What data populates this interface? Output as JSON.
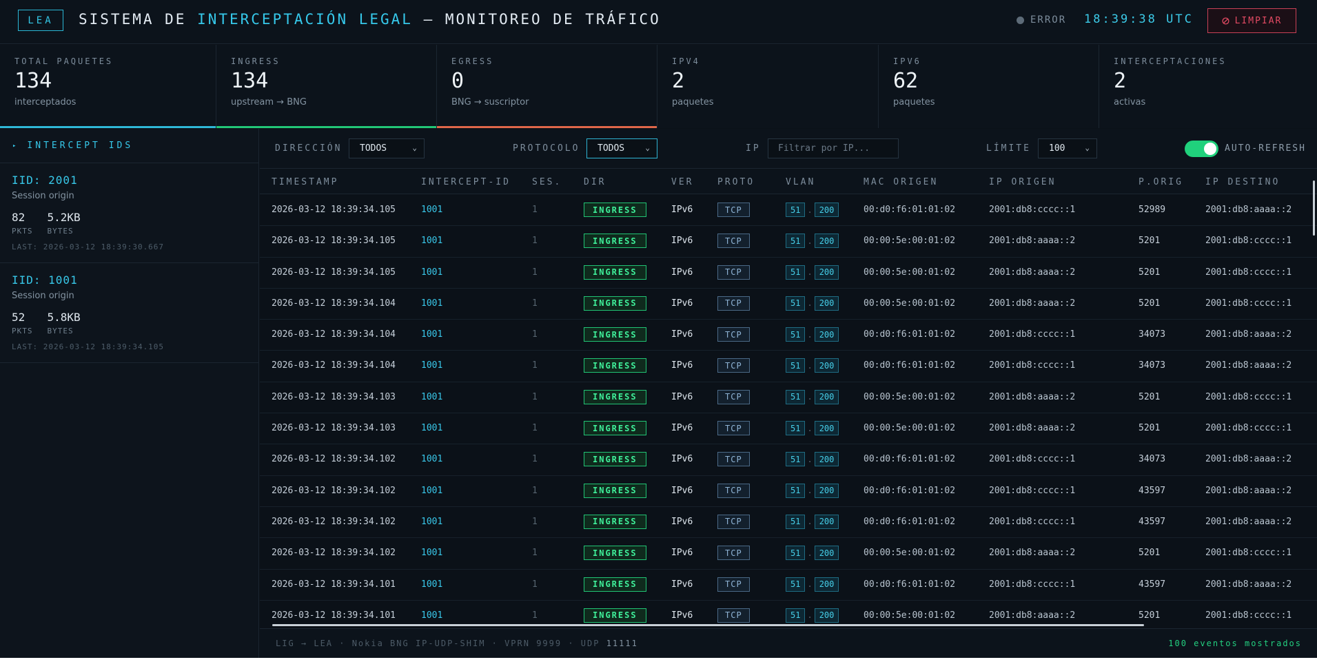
{
  "header": {
    "logo": "LEA",
    "title_pre": "SISTEMA DE ",
    "title_hl": "INTERCEPTACIÓN LEGAL",
    "title_post": " — MONITOREO DE TRÁFICO",
    "status": "ERROR",
    "clock": "18:39:38 UTC",
    "clear_label": "LIMPIAR",
    "clear_icon": "ban-icon"
  },
  "stats": [
    {
      "label": "TOTAL PAQUETES",
      "value": "134",
      "sub": "interceptados",
      "color": "#2fb8d8"
    },
    {
      "label": "INGRESS",
      "value": "134",
      "sub": "upstream → BNG",
      "color": "#22c777"
    },
    {
      "label": "EGRESS",
      "value": "0",
      "sub": "BNG → suscriptor",
      "color": "#e0674a"
    },
    {
      "label": "IPV4",
      "value": "2",
      "sub": "paquetes",
      "color": ""
    },
    {
      "label": "IPV6",
      "value": "62",
      "sub": "paquetes",
      "color": ""
    },
    {
      "label": "INTERCEPTACIONES",
      "value": "2",
      "sub": "activas",
      "color": ""
    }
  ],
  "sidebar": {
    "title": "INTERCEPT IDS",
    "cards": [
      {
        "iid": "IID: 2001",
        "origin": "Session origin",
        "pkts": "82",
        "bytes": "5.2KB",
        "pkts_label": "PKTS",
        "bytes_label": "BYTES",
        "last": "LAST: 2026-03-12 18:39:30.667"
      },
      {
        "iid": "IID: 1001",
        "origin": "Session origin",
        "pkts": "52",
        "bytes": "5.8KB",
        "pkts_label": "PKTS",
        "bytes_label": "BYTES",
        "last": "LAST: 2026-03-12 18:39:34.105"
      }
    ]
  },
  "filters": {
    "direction_label": "DIRECCIÓN",
    "direction_value": "TODOS",
    "protocol_label": "PROTOCOLO",
    "protocol_value": "TODOS",
    "ip_label": "IP",
    "ip_placeholder": "Filtrar por IP...",
    "limit_label": "LÍMITE",
    "limit_value": "100",
    "autorefresh_label": "AUTO-REFRESH",
    "autorefresh_on": true
  },
  "table": {
    "columns": [
      "TIMESTAMP",
      "INTERCEPT-ID",
      "SES.",
      "DIR",
      "VER",
      "PROTO",
      "VLAN",
      "MAC ORIGEN",
      "IP ORIGEN",
      "P.ORIG",
      "IP DESTINO"
    ],
    "rows": [
      {
        "ts": "2026-03-12 18:39:34.105",
        "iid": "1001",
        "ses": "1",
        "dir": "INGRESS",
        "ver": "IPv6",
        "proto": "TCP",
        "vlan_outer": "51",
        "vlan_inner": "200",
        "mac": "00:d0:f6:01:01:02",
        "ip_src": "2001:db8:cccc::1",
        "port": "52989",
        "ip_dst": "2001:db8:aaaa::2"
      },
      {
        "ts": "2026-03-12 18:39:34.105",
        "iid": "1001",
        "ses": "1",
        "dir": "INGRESS",
        "ver": "IPv6",
        "proto": "TCP",
        "vlan_outer": "51",
        "vlan_inner": "200",
        "mac": "00:00:5e:00:01:02",
        "ip_src": "2001:db8:aaaa::2",
        "port": "5201",
        "ip_dst": "2001:db8:cccc::1"
      },
      {
        "ts": "2026-03-12 18:39:34.105",
        "iid": "1001",
        "ses": "1",
        "dir": "INGRESS",
        "ver": "IPv6",
        "proto": "TCP",
        "vlan_outer": "51",
        "vlan_inner": "200",
        "mac": "00:00:5e:00:01:02",
        "ip_src": "2001:db8:aaaa::2",
        "port": "5201",
        "ip_dst": "2001:db8:cccc::1"
      },
      {
        "ts": "2026-03-12 18:39:34.104",
        "iid": "1001",
        "ses": "1",
        "dir": "INGRESS",
        "ver": "IPv6",
        "proto": "TCP",
        "vlan_outer": "51",
        "vlan_inner": "200",
        "mac": "00:00:5e:00:01:02",
        "ip_src": "2001:db8:aaaa::2",
        "port": "5201",
        "ip_dst": "2001:db8:cccc::1"
      },
      {
        "ts": "2026-03-12 18:39:34.104",
        "iid": "1001",
        "ses": "1",
        "dir": "INGRESS",
        "ver": "IPv6",
        "proto": "TCP",
        "vlan_outer": "51",
        "vlan_inner": "200",
        "mac": "00:d0:f6:01:01:02",
        "ip_src": "2001:db8:cccc::1",
        "port": "34073",
        "ip_dst": "2001:db8:aaaa::2"
      },
      {
        "ts": "2026-03-12 18:39:34.104",
        "iid": "1001",
        "ses": "1",
        "dir": "INGRESS",
        "ver": "IPv6",
        "proto": "TCP",
        "vlan_outer": "51",
        "vlan_inner": "200",
        "mac": "00:d0:f6:01:01:02",
        "ip_src": "2001:db8:cccc::1",
        "port": "34073",
        "ip_dst": "2001:db8:aaaa::2"
      },
      {
        "ts": "2026-03-12 18:39:34.103",
        "iid": "1001",
        "ses": "1",
        "dir": "INGRESS",
        "ver": "IPv6",
        "proto": "TCP",
        "vlan_outer": "51",
        "vlan_inner": "200",
        "mac": "00:00:5e:00:01:02",
        "ip_src": "2001:db8:aaaa::2",
        "port": "5201",
        "ip_dst": "2001:db8:cccc::1"
      },
      {
        "ts": "2026-03-12 18:39:34.103",
        "iid": "1001",
        "ses": "1",
        "dir": "INGRESS",
        "ver": "IPv6",
        "proto": "TCP",
        "vlan_outer": "51",
        "vlan_inner": "200",
        "mac": "00:00:5e:00:01:02",
        "ip_src": "2001:db8:aaaa::2",
        "port": "5201",
        "ip_dst": "2001:db8:cccc::1"
      },
      {
        "ts": "2026-03-12 18:39:34.102",
        "iid": "1001",
        "ses": "1",
        "dir": "INGRESS",
        "ver": "IPv6",
        "proto": "TCP",
        "vlan_outer": "51",
        "vlan_inner": "200",
        "mac": "00:d0:f6:01:01:02",
        "ip_src": "2001:db8:cccc::1",
        "port": "34073",
        "ip_dst": "2001:db8:aaaa::2"
      },
      {
        "ts": "2026-03-12 18:39:34.102",
        "iid": "1001",
        "ses": "1",
        "dir": "INGRESS",
        "ver": "IPv6",
        "proto": "TCP",
        "vlan_outer": "51",
        "vlan_inner": "200",
        "mac": "00:d0:f6:01:01:02",
        "ip_src": "2001:db8:cccc::1",
        "port": "43597",
        "ip_dst": "2001:db8:aaaa::2"
      },
      {
        "ts": "2026-03-12 18:39:34.102",
        "iid": "1001",
        "ses": "1",
        "dir": "INGRESS",
        "ver": "IPv6",
        "proto": "TCP",
        "vlan_outer": "51",
        "vlan_inner": "200",
        "mac": "00:d0:f6:01:01:02",
        "ip_src": "2001:db8:cccc::1",
        "port": "43597",
        "ip_dst": "2001:db8:aaaa::2"
      },
      {
        "ts": "2026-03-12 18:39:34.102",
        "iid": "1001",
        "ses": "1",
        "dir": "INGRESS",
        "ver": "IPv6",
        "proto": "TCP",
        "vlan_outer": "51",
        "vlan_inner": "200",
        "mac": "00:00:5e:00:01:02",
        "ip_src": "2001:db8:aaaa::2",
        "port": "5201",
        "ip_dst": "2001:db8:cccc::1"
      },
      {
        "ts": "2026-03-12 18:39:34.101",
        "iid": "1001",
        "ses": "1",
        "dir": "INGRESS",
        "ver": "IPv6",
        "proto": "TCP",
        "vlan_outer": "51",
        "vlan_inner": "200",
        "mac": "00:d0:f6:01:01:02",
        "ip_src": "2001:db8:cccc::1",
        "port": "43597",
        "ip_dst": "2001:db8:aaaa::2"
      },
      {
        "ts": "2026-03-12 18:39:34.101",
        "iid": "1001",
        "ses": "1",
        "dir": "INGRESS",
        "ver": "IPv6",
        "proto": "TCP",
        "vlan_outer": "51",
        "vlan_inner": "200",
        "mac": "00:00:5e:00:01:02",
        "ip_src": "2001:db8:aaaa::2",
        "port": "5201",
        "ip_dst": "2001:db8:cccc::1"
      }
    ]
  },
  "footer": {
    "text_pre": "LIG → LEA · Nokia BNG IP-UDP-SHIM · VPRN 9999 · UDP ",
    "port": "11111",
    "count": "100 eventos mostrados"
  }
}
